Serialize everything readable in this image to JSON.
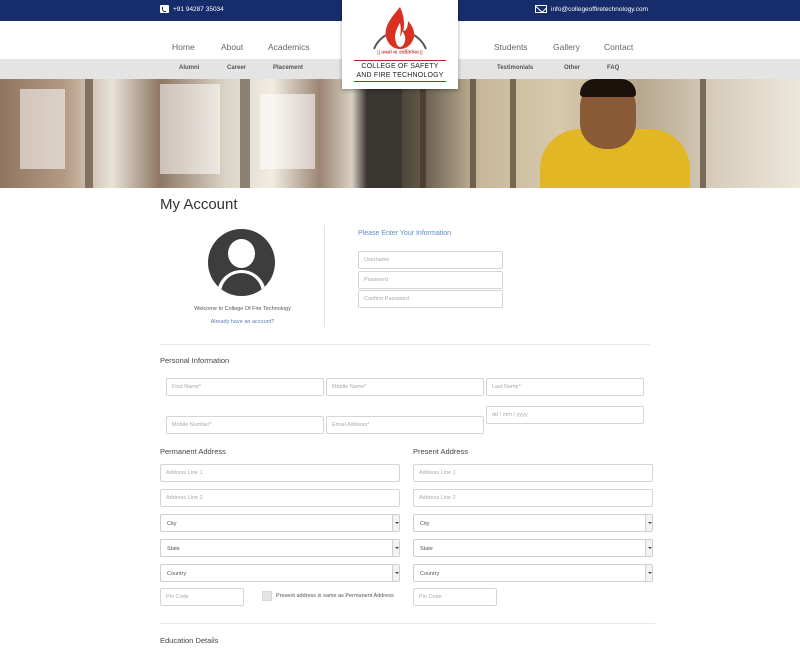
{
  "topbar": {
    "phone": "+91 94287 35034",
    "email": "info@collegeoffiretechnology.com"
  },
  "nav": {
    "home": "Home",
    "about": "About",
    "academics": "Academics",
    "students": "Students",
    "gallery": "Gallery",
    "contact": "Contact"
  },
  "subnav": {
    "alumni": "Alumni",
    "career": "Career",
    "placement": "Placement",
    "testimonials": "Testimonials",
    "other": "Other",
    "faq": "FAQ"
  },
  "logo": {
    "motto": "|| तमसो मा ज्योतिर्गमय ||",
    "line1": "COLLEGE OF SAFETY",
    "line2": "AND FIRE TECHNOLOGY"
  },
  "page": {
    "title": "My Account"
  },
  "account": {
    "welcome": "Welcome to College Of Fire Technology",
    "already": "Already have an account?",
    "please": "Please Enter Your Information",
    "username_ph": "Username",
    "password_ph": "Password",
    "confirm_ph": "Confirm Password"
  },
  "personal": {
    "heading": "Personal Information",
    "first_ph": "First Name*",
    "middle_ph": "Middle Name*",
    "last_ph": "Last Name*",
    "mobile_ph": "Mobile Number*",
    "email_ph": "Email Address*",
    "dob_ph": "dd / mm / yyyy"
  },
  "permanent": {
    "heading": "Permanent Address",
    "addr1_ph": "Address Line 1",
    "addr2_ph": "Address Line 2",
    "city": "City",
    "state": "State",
    "country": "Country",
    "pin_ph": "Pin Code"
  },
  "present": {
    "heading": "Present Address",
    "addr1_ph": "Address Line 1",
    "addr2_ph": "Address Line 2",
    "city": "City",
    "state": "State",
    "country": "Country",
    "pin_ph": "Pin Code",
    "same_label": "Present address is same as Permanent Address"
  },
  "education": {
    "heading": "Education Details"
  },
  "colors": {
    "topbar": "#172c6b",
    "accent": "#5b8ec9",
    "subnav": "#e4e4e4"
  }
}
